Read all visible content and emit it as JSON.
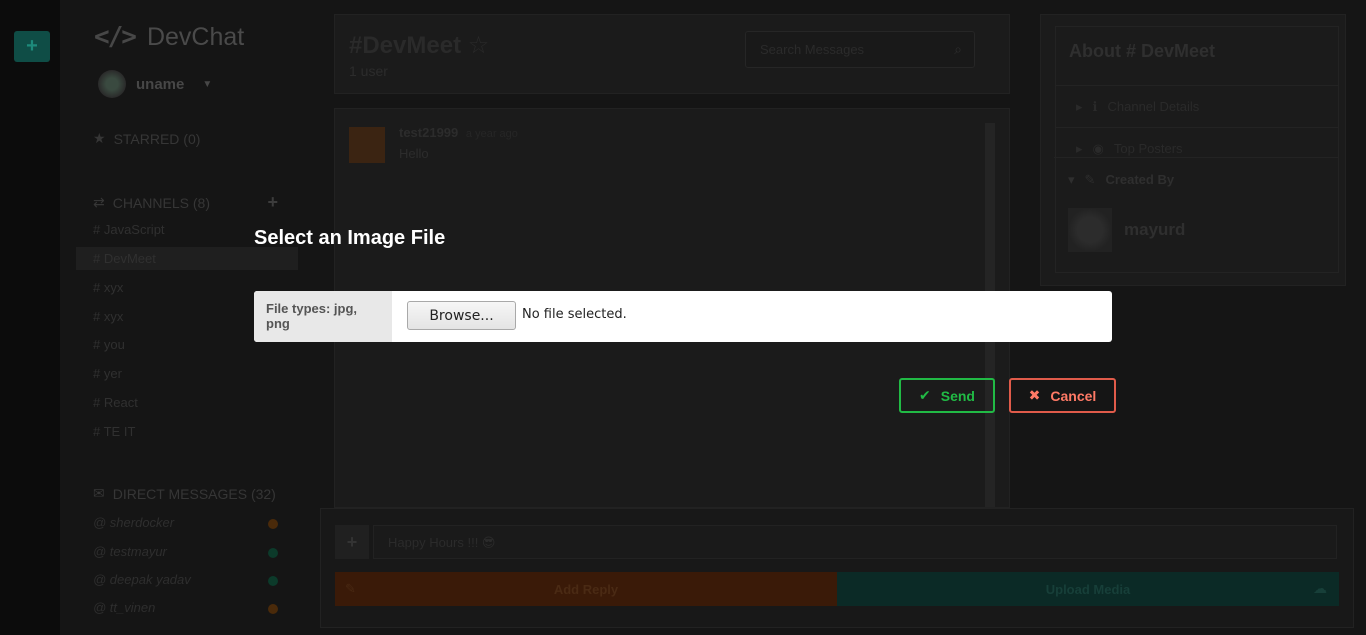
{
  "rail": {
    "add_label": "+"
  },
  "sidebar": {
    "brand": {
      "logo": "</>",
      "name": "DevChat"
    },
    "user": {
      "name": "uname"
    },
    "starred": {
      "label": "STARRED (0)"
    },
    "channels": {
      "label": "CHANNELS (8)",
      "add": "+",
      "items": [
        "# JavaScript",
        "# DevMeet",
        "# xyx",
        "# xyx",
        "# you",
        "# yer",
        "# React",
        "# TE IT"
      ]
    },
    "direct_messages": {
      "label": "DIRECT MESSAGES (32)",
      "items": [
        {
          "name": "@ sherdocker",
          "status_color": "#4a2a0a"
        },
        {
          "name": "@ testmayur",
          "status_color": "#0c3a2a"
        },
        {
          "name": "@ deepak yadav",
          "status_color": "#0c3a2a"
        },
        {
          "name": "@ tt_vinen",
          "status_color": "#4a2a0a"
        }
      ]
    }
  },
  "channel": {
    "title": "#DevMeet",
    "users": "1 user",
    "search_placeholder": "Search Messages",
    "message": {
      "user": "test21999",
      "time": "a year ago",
      "text": "Hello"
    }
  },
  "about": {
    "title": "About # DevMeet",
    "rows": {
      "details": "Channel Details",
      "posters": "Top Posters",
      "created": "Created By"
    },
    "creator": "mayurd"
  },
  "composer": {
    "value": "Happy Hours !!! 😎",
    "reply_label": "Add Reply",
    "upload_label": "Upload Media"
  },
  "modal": {
    "title": "Select an Image File",
    "file_types": "File types: jpg, png",
    "browse_label": "Browse...",
    "status": "No file selected.",
    "send_label": "Send",
    "cancel_label": "Cancel"
  }
}
